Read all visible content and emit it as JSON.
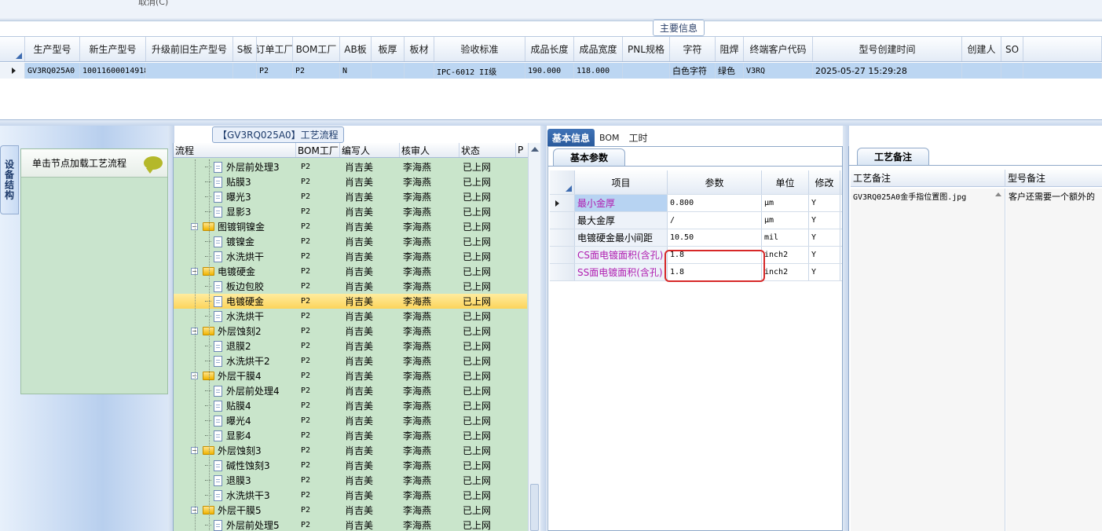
{
  "top": {
    "cut_label": "取消(C)"
  },
  "main_info": {
    "section_title": "主要信息",
    "columns": [
      "生产型号",
      "新生产型号",
      "升级前旧生产型号",
      "S板",
      "订单工厂",
      "BOM工厂",
      "AB板",
      "板厚",
      "板材",
      "验收标准",
      "成品长度",
      "成品宽度",
      "PNL规格",
      "字符",
      "阻焊",
      "终端客户代码",
      "型号创建时间",
      "创建人",
      "SO"
    ],
    "row": {
      "生产型号": "GV3RQ025A0",
      "新生产型号": "10011600014918",
      "订单工厂": "P2",
      "BOM工厂": "P2",
      "AB板": "N",
      "验收标准": "IPC-6012 II级",
      "成品长度": "190.000",
      "成品宽度": "118.000",
      "字符": "白色字符",
      "阻焊": "绿色",
      "终端客户代码": "V3RQ",
      "型号创建时间": "2025-05-27 15:29:28"
    }
  },
  "left_dock": {
    "vertical_tab": "设备结构",
    "load_hint": "单击节点加载工艺流程",
    "load_icon": "speech-bubble-icon"
  },
  "process": {
    "title": "【GV3RQ025A0】工艺流程",
    "headers": [
      "流程",
      "BOM工厂",
      "编写人",
      "核审人",
      "状态",
      "P"
    ],
    "rows": [
      {
        "name": "外层前处理3",
        "level": 2,
        "folder": false,
        "bom": "P2",
        "writer": "肖吉美",
        "reviewer": "李海燕",
        "status": "已上网"
      },
      {
        "name": "贴膜3",
        "level": 2,
        "folder": false,
        "bom": "P2",
        "writer": "肖吉美",
        "reviewer": "李海燕",
        "status": "已上网"
      },
      {
        "name": "曝光3",
        "level": 2,
        "folder": false,
        "bom": "P2",
        "writer": "肖吉美",
        "reviewer": "李海燕",
        "status": "已上网"
      },
      {
        "name": "显影3",
        "level": 2,
        "folder": false,
        "bom": "P2",
        "writer": "肖吉美",
        "reviewer": "李海燕",
        "status": "已上网"
      },
      {
        "name": "图镀铜镍金",
        "level": 1,
        "folder": true,
        "bom": "P2",
        "writer": "肖吉美",
        "reviewer": "李海燕",
        "status": "已上网"
      },
      {
        "name": "镀镍金",
        "level": 2,
        "folder": false,
        "bom": "P2",
        "writer": "肖吉美",
        "reviewer": "李海燕",
        "status": "已上网"
      },
      {
        "name": "水洗烘干",
        "level": 2,
        "folder": false,
        "bom": "P2",
        "writer": "肖吉美",
        "reviewer": "李海燕",
        "status": "已上网"
      },
      {
        "name": "电镀硬金",
        "level": 1,
        "folder": true,
        "bom": "P2",
        "writer": "肖吉美",
        "reviewer": "李海燕",
        "status": "已上网"
      },
      {
        "name": "板边包胶",
        "level": 2,
        "folder": false,
        "bom": "P2",
        "writer": "肖吉美",
        "reviewer": "李海燕",
        "status": "已上网"
      },
      {
        "name": "电镀硬金",
        "level": 2,
        "folder": false,
        "bom": "P2",
        "writer": "肖吉美",
        "reviewer": "李海燕",
        "status": "已上网",
        "selected": true
      },
      {
        "name": "水洗烘干",
        "level": 2,
        "folder": false,
        "bom": "P2",
        "writer": "肖吉美",
        "reviewer": "李海燕",
        "status": "已上网"
      },
      {
        "name": "外层蚀刻2",
        "level": 1,
        "folder": true,
        "bom": "P2",
        "writer": "肖吉美",
        "reviewer": "李海燕",
        "status": "已上网"
      },
      {
        "name": "退膜2",
        "level": 2,
        "folder": false,
        "bom": "P2",
        "writer": "肖吉美",
        "reviewer": "李海燕",
        "status": "已上网"
      },
      {
        "name": "水洗烘干2",
        "level": 2,
        "folder": false,
        "bom": "P2",
        "writer": "肖吉美",
        "reviewer": "李海燕",
        "status": "已上网"
      },
      {
        "name": "外层干膜4",
        "level": 1,
        "folder": true,
        "bom": "P2",
        "writer": "肖吉美",
        "reviewer": "李海燕",
        "status": "已上网"
      },
      {
        "name": "外层前处理4",
        "level": 2,
        "folder": false,
        "bom": "P2",
        "writer": "肖吉美",
        "reviewer": "李海燕",
        "status": "已上网"
      },
      {
        "name": "贴膜4",
        "level": 2,
        "folder": false,
        "bom": "P2",
        "writer": "肖吉美",
        "reviewer": "李海燕",
        "status": "已上网"
      },
      {
        "name": "曝光4",
        "level": 2,
        "folder": false,
        "bom": "P2",
        "writer": "肖吉美",
        "reviewer": "李海燕",
        "status": "已上网"
      },
      {
        "name": "显影4",
        "level": 2,
        "folder": false,
        "bom": "P2",
        "writer": "肖吉美",
        "reviewer": "李海燕",
        "status": "已上网"
      },
      {
        "name": "外层蚀刻3",
        "level": 1,
        "folder": true,
        "bom": "P2",
        "writer": "肖吉美",
        "reviewer": "李海燕",
        "status": "已上网"
      },
      {
        "name": "碱性蚀刻3",
        "level": 2,
        "folder": false,
        "bom": "P2",
        "writer": "肖吉美",
        "reviewer": "李海燕",
        "status": "已上网"
      },
      {
        "name": "退膜3",
        "level": 2,
        "folder": false,
        "bom": "P2",
        "writer": "肖吉美",
        "reviewer": "李海燕",
        "status": "已上网"
      },
      {
        "name": "水洗烘干3",
        "level": 2,
        "folder": false,
        "bom": "P2",
        "writer": "肖吉美",
        "reviewer": "李海燕",
        "status": "已上网"
      },
      {
        "name": "外层干膜5",
        "level": 1,
        "folder": true,
        "bom": "P2",
        "writer": "肖吉美",
        "reviewer": "李海燕",
        "status": "已上网"
      },
      {
        "name": "外层前处理5",
        "level": 2,
        "folder": false,
        "bom": "P2",
        "writer": "肖吉美",
        "reviewer": "李海燕",
        "status": "已上网"
      }
    ]
  },
  "tabs": [
    "基本信息",
    "BOM",
    "工时"
  ],
  "basic": {
    "subtab": "基本参数",
    "headers": [
      "项目",
      "参数",
      "单位",
      "修改"
    ],
    "rows": [
      {
        "item": "最小金厚",
        "value": "0.800",
        "unit": "μm",
        "modify": "Y",
        "style": "purple-selected",
        "current": true
      },
      {
        "item": "最大金厚",
        "value": "/",
        "unit": "μm",
        "modify": "Y",
        "style": "normal"
      },
      {
        "item": "电镀硬金最小间距",
        "value": "10.50",
        "unit": "mil",
        "modify": "Y",
        "style": "normal"
      },
      {
        "item": "CS面电镀面积(含孔)",
        "value": "1.8",
        "unit": "inch2",
        "modify": "Y",
        "style": "purple"
      },
      {
        "item": "SS面电镀面积(含孔)",
        "value": "1.8",
        "unit": "inch2",
        "modify": "Y",
        "style": "purple"
      }
    ]
  },
  "notes": {
    "subtab": "工艺备注",
    "headers": [
      "工艺备注",
      "型号备注"
    ],
    "process_note": "GV3RQ025A0金手指位置图.jpg",
    "model_note": "客户还需要一个额外的"
  }
}
